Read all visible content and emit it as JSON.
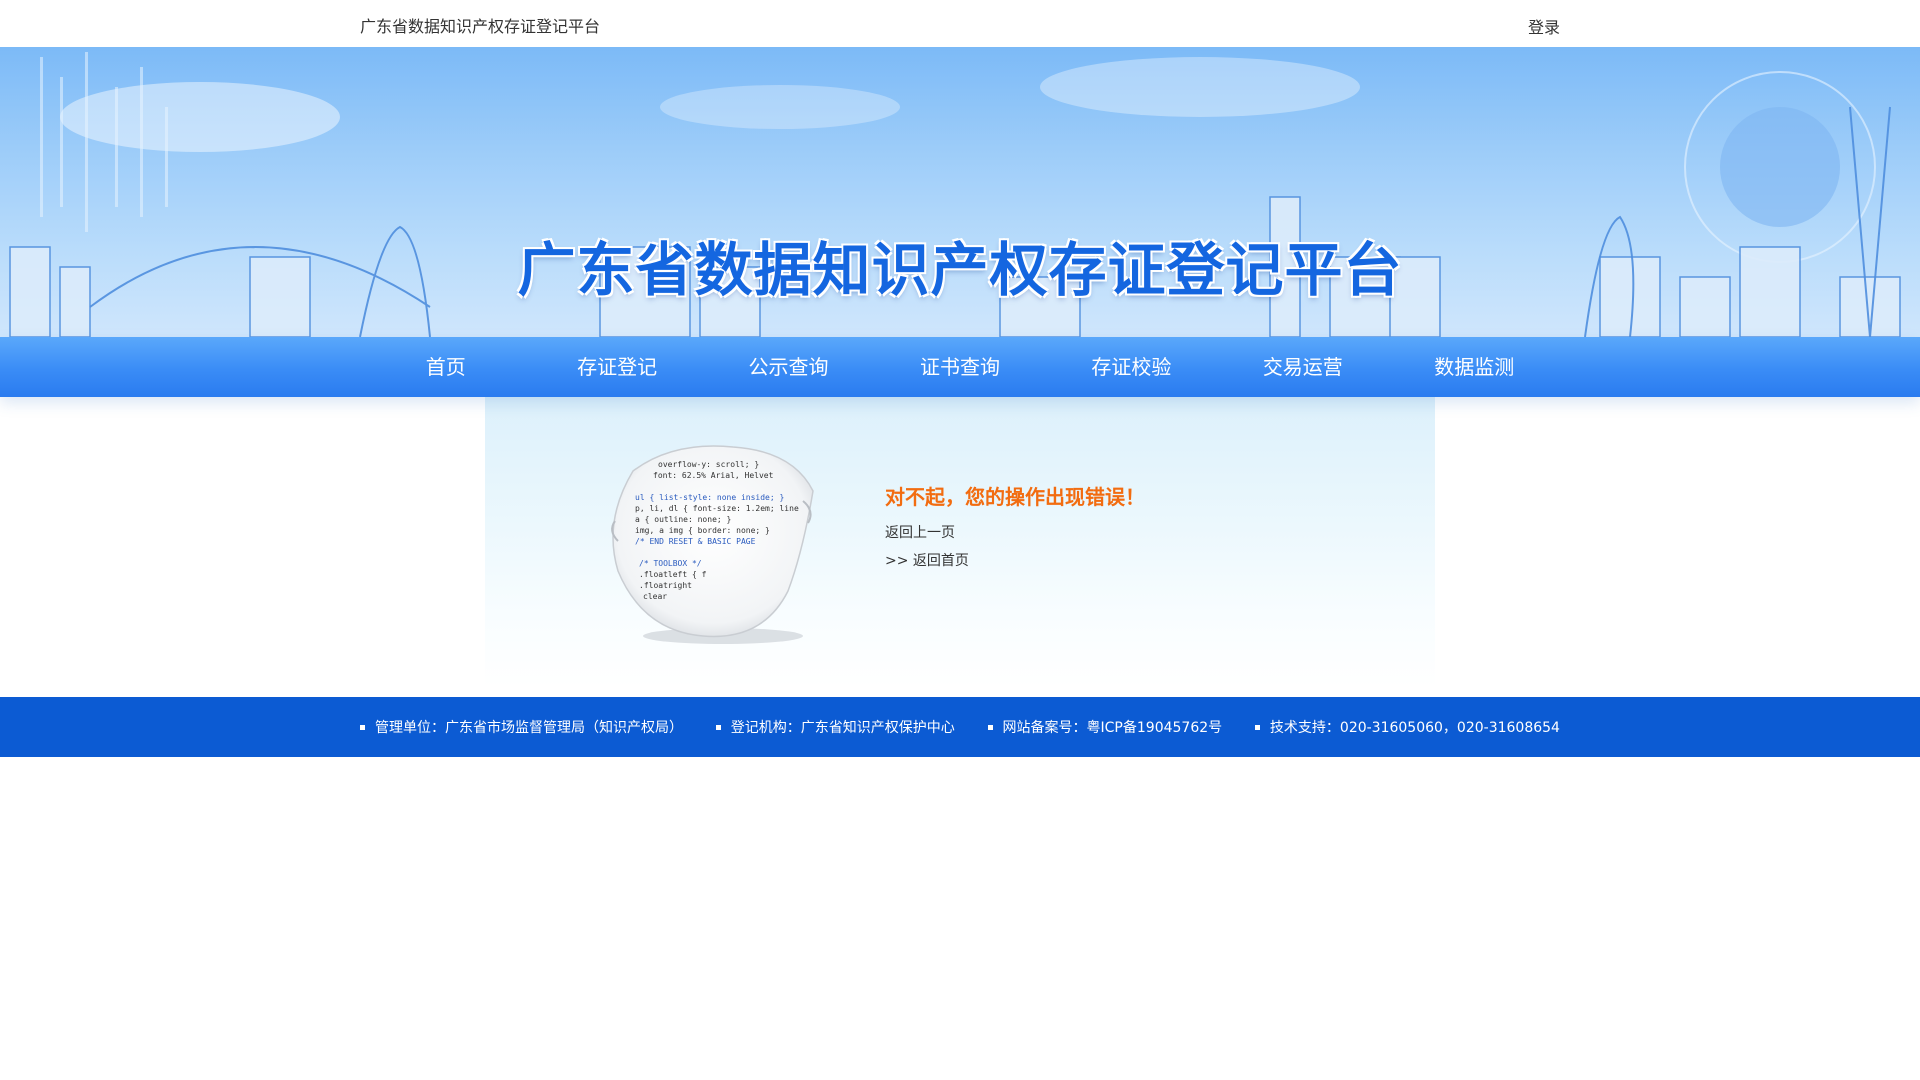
{
  "header": {
    "site_name": "广东省数据知识产权存证登记平台",
    "login": "登录"
  },
  "banner": {
    "title": "广东省数据知识产权存证登记平台"
  },
  "nav": {
    "items": [
      {
        "label": "首页"
      },
      {
        "label": "存证登记"
      },
      {
        "label": "公示查询"
      },
      {
        "label": "证书查询"
      },
      {
        "label": "存证校验"
      },
      {
        "label": "交易运营"
      },
      {
        "label": "数据监测"
      }
    ]
  },
  "error": {
    "title": "对不起，您的操作出现错误！",
    "back_link": "返回上一页",
    "home_link": ">> 返回首页",
    "illustration_code": [
      "overflow-y: scroll; }",
      "font: 62.5% Arial, Helvet",
      "ul { list-style: none inside; }",
      "p, li, dl { font-size: 1.2em; line",
      "a { outline: none; }",
      "img, a img { border: none; }",
      "/* END RESET & BASIC PAGE",
      "/* TOOLBOX */",
      ".floatleft { f",
      ".floatright",
      "clear"
    ]
  },
  "footer": {
    "items": [
      {
        "label": "管理单位：广东省市场监督管理局（知识产权局）"
      },
      {
        "label": "登记机构：广东省知识产权保护中心"
      },
      {
        "label": "网站备案号：粤ICP备19045762号"
      },
      {
        "label": "技术支持：020-31605060，020-31608654"
      }
    ]
  },
  "colors": {
    "nav_blue": "#3a8cf6",
    "footer_blue": "#0c5bd3",
    "error_orange": "#f26c10",
    "title_blue": "#1466e0"
  }
}
